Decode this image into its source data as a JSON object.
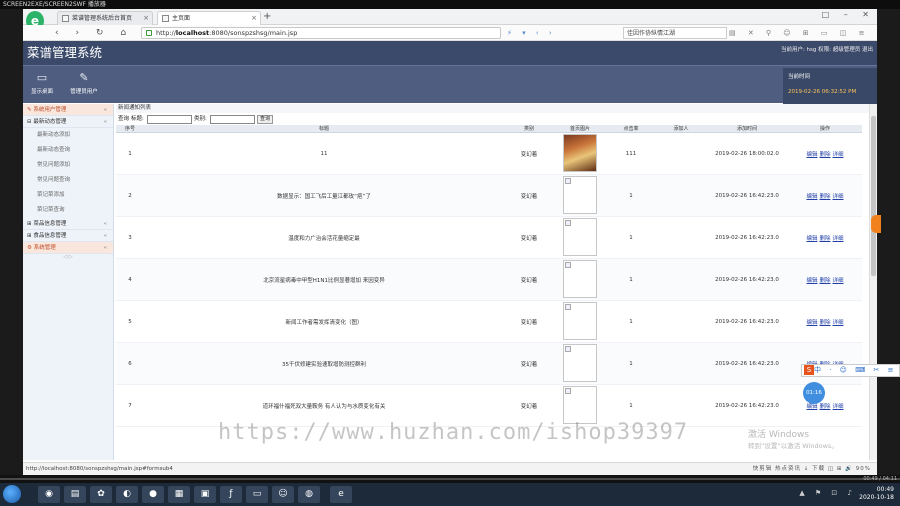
{
  "player": {
    "title": "SCREEN2EXE/SCREEN2SWF 播放器"
  },
  "browser": {
    "tabs": [
      {
        "label": "菜谱管理系统后台首页",
        "active": false
      },
      {
        "label": "主页面",
        "active": true
      }
    ],
    "new_tab": "+",
    "url_prefix": "http://",
    "url_host": "localhost",
    "url_rest": ":8080/sonspzshsg/main.jsp",
    "search_text": "佳因作协纵情江湖",
    "nav_icons": "‹ › ↻ ⌂ ☆",
    "url_icons": "⚡ ▾ ‹ ›",
    "tool_icons": "▤ ✕ ⚲ ☺ ⊞ ▭ ◫ ≡ ▣ ☰",
    "window_controls": "□ – ✕"
  },
  "app": {
    "title": "菜谱管理系统",
    "user_info": "当前用户: hsg  权限: 超级管理员  退出",
    "toolbar": [
      {
        "label": "显示桌面",
        "icon": "monitor-icon"
      },
      {
        "label": "管理员用户",
        "icon": "pencil-icon"
      }
    ],
    "time_box": {
      "label": "当前时间",
      "value": "2019-02-26 06:32:52 PM"
    }
  },
  "sidebar": {
    "sections": [
      {
        "label": "系统用户管理",
        "style": "red"
      },
      {
        "label": "最新动态管理",
        "style": "normal"
      }
    ],
    "sub_items": [
      "最新动态添加",
      "最新动态查询",
      "常见问题添加",
      "常见问题查询",
      "菜记菜添加",
      "菜记菜查询"
    ],
    "more_sections": [
      {
        "label": "菜品信息管理",
        "style": "normal"
      },
      {
        "label": "食品信息管理",
        "style": "normal"
      },
      {
        "label": "系统管理",
        "style": "red"
      }
    ],
    "pager": "◁ ▷"
  },
  "content": {
    "breadcrumb": "新闻通知列表",
    "query": {
      "label": "查询",
      "title_label": "标题:",
      "category_label": "类别:",
      "button": "查询"
    },
    "columns": [
      "序号",
      "标题",
      "类别",
      "首页图片",
      "点击率",
      "添加人",
      "添加时间",
      "操作"
    ],
    "rows": [
      {
        "no": "1",
        "title": "11",
        "category": "变幻着",
        "image": "photo",
        "clicks": "111",
        "adder": "",
        "time": "2019-02-26 18:00:02.0"
      },
      {
        "no": "2",
        "title": "数据显示：国工飞后工量江都玫“疤”了",
        "category": "变幻着",
        "image": "broken",
        "clicks": "1",
        "adder": "",
        "time": "2019-02-26 16:42:23.0"
      },
      {
        "no": "3",
        "title": "温度和力广治会活花量缩定最",
        "category": "变幻着",
        "image": "broken",
        "clicks": "1",
        "adder": "",
        "time": "2019-02-26 16:42:23.0"
      },
      {
        "no": "4",
        "title": "北京流星病毒中甲型H1N1比例显著增加 来因变异",
        "category": "变幻着",
        "image": "broken",
        "clicks": "1",
        "adder": "",
        "time": "2019-02-26 16:42:23.0"
      },
      {
        "no": "5",
        "title": "新闻工作者需发挥清变化（图）",
        "category": "变幻着",
        "image": "broken",
        "clicks": "1",
        "adder": "",
        "time": "2019-02-26 16:42:23.0"
      },
      {
        "no": "6",
        "title": "35千伏修建实验速取增防测控群利",
        "category": "变幻着",
        "image": "broken",
        "clicks": "1",
        "adder": "",
        "time": "2019-02-26 16:42:23.0"
      },
      {
        "no": "7",
        "title": "道环福什福死双大量鞍务 有人认为与水质变化有关",
        "category": "变幻着",
        "image": "broken",
        "clicks": "1",
        "adder": "",
        "time": "2019-02-26 16:42:23.0"
      }
    ],
    "ops": [
      "编辑",
      "删除",
      "详细"
    ]
  },
  "statusbar": {
    "url": "http://localhost:8080/sonspzshsg/main.jsp#formsub4",
    "right": "快剪辑  热点资讯  ↓ 下载  ◫  ⊞  🔊  90%"
  },
  "overlay": {
    "watermark": "https://www.huzhan.com/ishop39397",
    "activate_title": "激活 Windows",
    "activate_sub": "转到“设置”以激活 Windows。",
    "float_timer": "01:16",
    "ime": "中 · ☺ ⌨ ✂ ≡"
  },
  "player_timebar": {
    "time": "00:49 / 04:11"
  },
  "taskbar": {
    "clock_time": "00:49",
    "clock_date": "2020-10-18",
    "tray": "▲ ⚑ ⊡ ♪"
  }
}
